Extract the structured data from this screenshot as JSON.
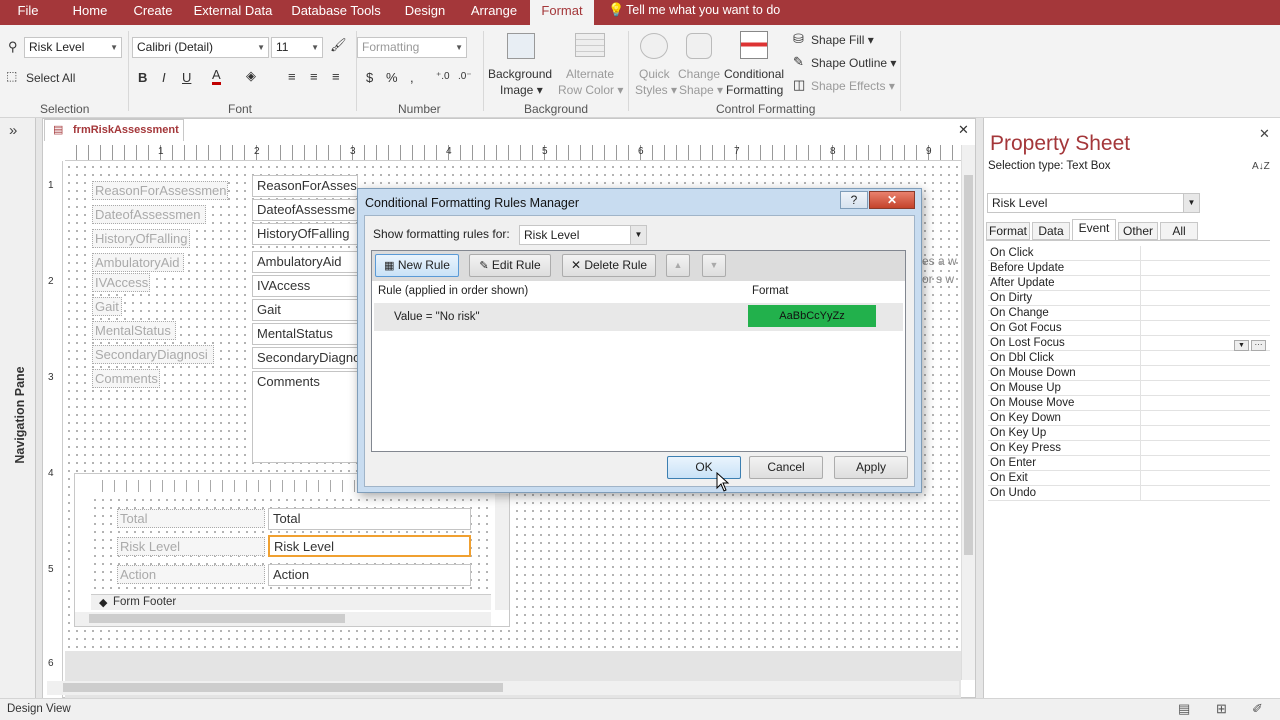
{
  "menu": {
    "file": "File",
    "home": "Home",
    "create": "Create",
    "external": "External Data",
    "dbtools": "Database Tools",
    "design": "Design",
    "arrange": "Arrange",
    "format": "Format",
    "tellme": "Tell me what you want to do"
  },
  "ribbon": {
    "selection_combo": "Risk Level",
    "select_all": "Select All",
    "font_name": "Calibri (Detail)",
    "font_size": "11",
    "number_format": "Formatting",
    "background_image": "Background",
    "background_image2": "Image",
    "alternate_row": "Alternate",
    "alternate_row2": "Row Color",
    "quick_styles": "Quick",
    "quick_styles2": "Styles",
    "change_shape": "Change",
    "change_shape2": "Shape",
    "conditional_formatting": "Conditional",
    "conditional_formatting2": "Formatting",
    "shape_fill": "Shape Fill",
    "shape_outline": "Shape Outline",
    "shape_effects": "Shape Effects",
    "groups": {
      "selection": "Selection",
      "font": "Font",
      "number": "Number",
      "background": "Background",
      "control_formatting": "Control Formatting"
    },
    "icons": {
      "bold": "B",
      "italic": "I",
      "underline": "U",
      "font_color": "A",
      "currency": "$",
      "percent": "%",
      "comma": ","
    }
  },
  "nav": {
    "label": "Navigation Pane",
    "toggle": "»"
  },
  "doc": {
    "tab": "frmRiskAssessment",
    "close": "✕",
    "ruler_numbers": [
      "1",
      "2",
      "3",
      "4",
      "5",
      "6",
      "7",
      "8",
      "9"
    ],
    "vruler_numbers": [
      "1",
      "2",
      "3",
      "4",
      "5",
      "6"
    ],
    "labels": [
      "ReasonForAssessmen",
      "DateofAssessmen",
      "HistoryOfFalling",
      "AmbulatoryAid",
      "IVAccess",
      "Gait",
      "MentalStatus",
      "SecondaryDiagnosi",
      "Comments"
    ],
    "fields": [
      "ReasonForAssessment",
      "DateofAssessme",
      "HistoryOfFalling",
      "AmbulatoryAid",
      "IVAccess",
      "Gait",
      "MentalStatus",
      "SecondaryDiagno",
      "Comments"
    ],
    "subform_labels": [
      "Total",
      "Risk Level",
      "Action"
    ],
    "subform_fields": [
      "Total",
      "Risk Level",
      "Action"
    ],
    "form_footer": "Form Footer",
    "right_snippet1": "es a w",
    "right_snippet2": "or s w"
  },
  "dialog": {
    "title": "Conditional Formatting Rules Manager",
    "help": "?",
    "close": "✕",
    "show_label": "Show formatting rules for:",
    "show_value": "Risk Level",
    "new_rule": "New Rule",
    "edit_rule": "Edit Rule",
    "delete_rule": "Delete Rule",
    "col_rule": "Rule (applied in order shown)",
    "col_format": "Format",
    "rules": [
      {
        "rule": "Value = \"No risk\"",
        "format": "AaBbCcYyZz",
        "format_color": "#22b14c"
      }
    ],
    "ok": "OK",
    "cancel": "Cancel",
    "apply": "Apply"
  },
  "property_sheet": {
    "title": "Property Sheet",
    "selection_type": "Selection type:  Text Box",
    "sort": "A↓Z",
    "close": "✕",
    "object": "Risk Level",
    "tabs": [
      "Format",
      "Data",
      "Event",
      "Other",
      "All"
    ],
    "active_tab": "Event",
    "events": [
      "On Click",
      "Before Update",
      "After Update",
      "On Dirty",
      "On Change",
      "On Got Focus",
      "On Lost Focus",
      "On Dbl Click",
      "On Mouse Down",
      "On Mouse Up",
      "On Mouse Move",
      "On Key Down",
      "On Key Up",
      "On Key Press",
      "On Enter",
      "On Exit",
      "On Undo"
    ]
  },
  "status": {
    "view": "Design View"
  },
  "colors": {
    "accent": "#a4373a",
    "dialog_bg": "#c8dcf0",
    "selected_outline": "#f0a030",
    "format_green": "#22b14c"
  }
}
